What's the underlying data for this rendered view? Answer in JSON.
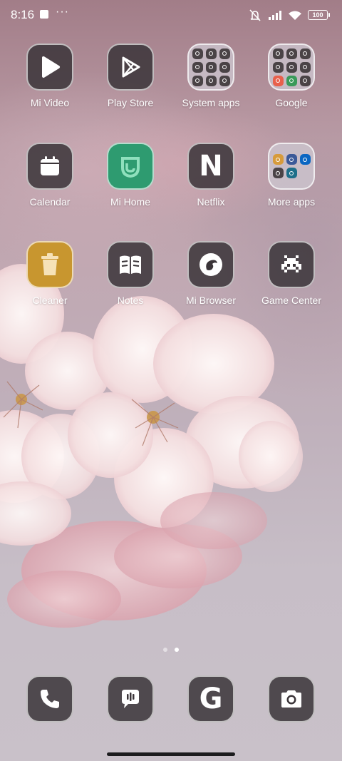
{
  "status_bar": {
    "time": "8:16",
    "more": "···",
    "battery": "100"
  },
  "apps": {
    "row1": [
      "Mi Video",
      "Play Store",
      "System apps",
      "Google"
    ],
    "row2": [
      "Calendar",
      "Mi Home",
      "Netflix",
      "More apps"
    ],
    "row3": [
      "Cleaner",
      "Notes",
      "Mi Browser",
      "Game Center"
    ]
  },
  "netflix_letter": "N",
  "google_letter": "G",
  "pages": {
    "count": 2,
    "active": 2
  },
  "dock": [
    "phone-icon",
    "messages-icon",
    "google-icon",
    "camera-icon"
  ],
  "colors": {
    "icon_bg": "#3a3438",
    "mihome": "#2e9b70",
    "cleaner": "#c8962f"
  }
}
